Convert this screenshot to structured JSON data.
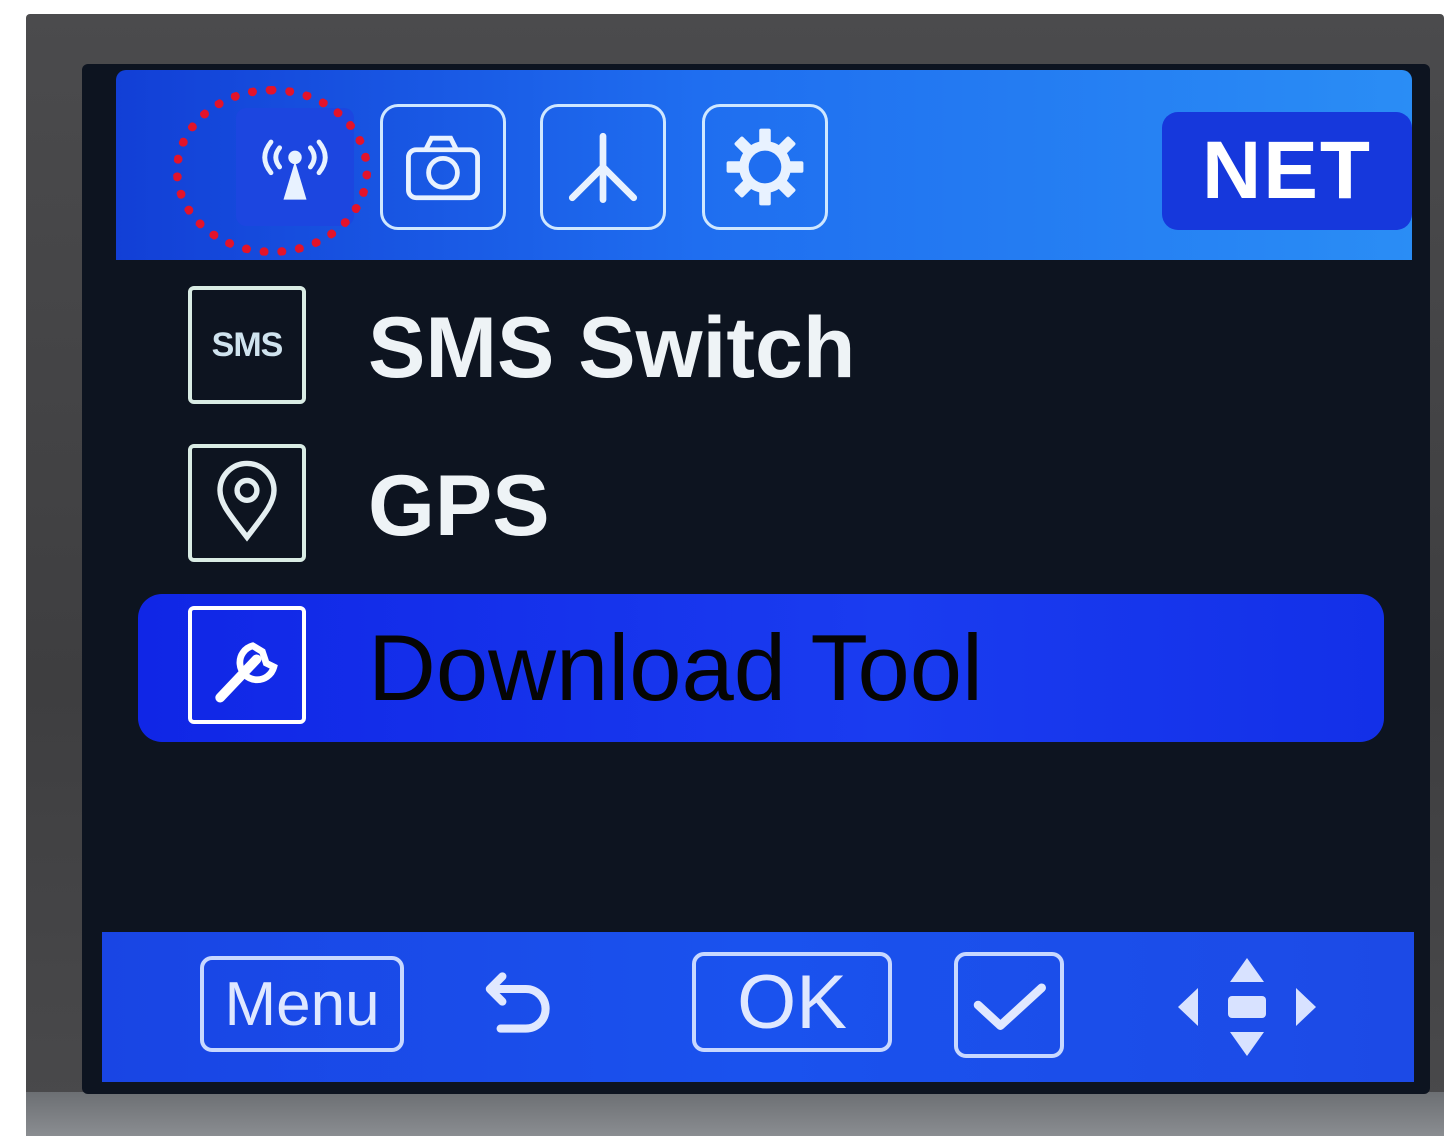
{
  "header": {
    "tabs": [
      {
        "icon": "antenna-icon",
        "active": true
      },
      {
        "icon": "camera-icon",
        "active": false
      },
      {
        "icon": "tripod-icon",
        "active": false
      },
      {
        "icon": "gear-icon",
        "active": false
      }
    ],
    "mode_badge": "NET",
    "highlight_color": "#e3132a"
  },
  "menu": {
    "items": [
      {
        "label": "SMS Switch",
        "icon": "sms-icon",
        "icon_text": "SMS",
        "selected": false
      },
      {
        "label": "GPS",
        "icon": "location-pin-icon",
        "selected": false
      },
      {
        "label": "Download Tool",
        "icon": "wrench-icon",
        "selected": true
      }
    ]
  },
  "footer": {
    "menu_key": "Menu",
    "back_icon": "return-arrow-icon",
    "ok_key": "OK",
    "confirm_icon": "checkmark-icon",
    "nav_icon": "direction-pad-icon"
  },
  "colors": {
    "bar_blue": "#1a52ee",
    "selection_blue": "#1a3cf0",
    "screen_bg": "#0d1420"
  }
}
